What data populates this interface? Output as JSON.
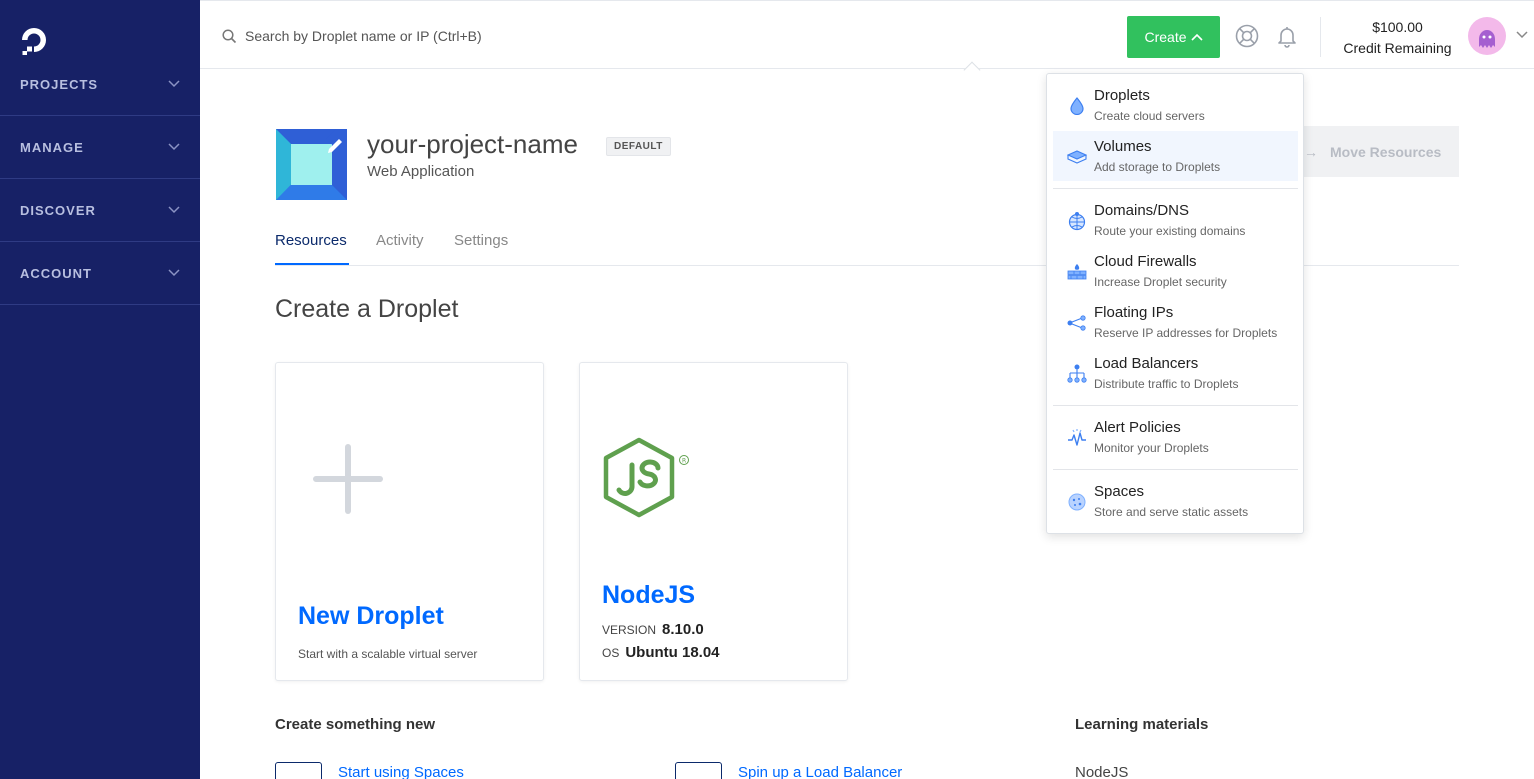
{
  "sidebar": {
    "items": [
      {
        "label": "PROJECTS"
      },
      {
        "label": "MANAGE"
      },
      {
        "label": "DISCOVER"
      },
      {
        "label": "ACCOUNT"
      }
    ]
  },
  "topbar": {
    "search_placeholder": "Search by Droplet name or IP (Ctrl+B)",
    "create_label": "Create",
    "credit_amount": "$100.00",
    "credit_label": "Credit Remaining"
  },
  "project": {
    "name": "your-project-name",
    "badge": "DEFAULT",
    "subtitle": "Web Application",
    "move_label": "Move Resources"
  },
  "tabs": [
    {
      "label": "Resources",
      "active": true
    },
    {
      "label": "Activity",
      "active": false
    },
    {
      "label": "Settings",
      "active": false
    }
  ],
  "main": {
    "section_title": "Create a Droplet",
    "cards": {
      "new_droplet": {
        "title": "New Droplet",
        "desc": "Start with a scalable virtual server"
      },
      "nodejs": {
        "title": "NodeJS",
        "version_label": "VERSION",
        "version_value": "8.10.0",
        "os_label": "OS",
        "os_value": "Ubuntu 18.04"
      }
    },
    "create_new_heading": "Create something new",
    "create_new_links": [
      "Start using Spaces",
      "Spin up a Load Balancer"
    ],
    "learning_heading": "Learning materials",
    "learning_items": [
      "NodeJS"
    ]
  },
  "dropdown": {
    "items": [
      {
        "title": "Droplets",
        "desc": "Create cloud servers",
        "icon": "droplet-icon"
      },
      {
        "title": "Volumes",
        "desc": "Add storage to Droplets",
        "icon": "volumes-icon"
      },
      {
        "title": "Domains/DNS",
        "desc": "Route your existing domains",
        "icon": "globe-icon"
      },
      {
        "title": "Cloud Firewalls",
        "desc": "Increase Droplet security",
        "icon": "firewall-icon"
      },
      {
        "title": "Floating IPs",
        "desc": "Reserve IP addresses for Droplets",
        "icon": "floating-ip-icon"
      },
      {
        "title": "Load Balancers",
        "desc": "Distribute traffic to Droplets",
        "icon": "load-balancer-icon"
      },
      {
        "title": "Alert Policies",
        "desc": "Monitor your Droplets",
        "icon": "alert-icon"
      },
      {
        "title": "Spaces",
        "desc": "Store and serve static assets",
        "icon": "spaces-icon"
      }
    ]
  },
  "colors": {
    "sidebar": "#172166",
    "accent": "#0069ff",
    "create": "#31c15e",
    "node_green": "#5fa04e"
  }
}
